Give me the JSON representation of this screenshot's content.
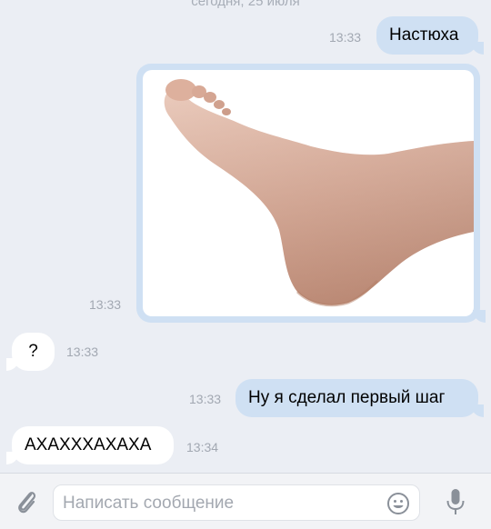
{
  "chat": {
    "date_separator": "сегодня, 25 июля",
    "messages": [
      {
        "direction": "outgoing",
        "type": "text",
        "text": "Настюха",
        "time": "13:33"
      },
      {
        "direction": "outgoing",
        "type": "photo",
        "photo_subject": "bare foot",
        "time": "13:33"
      },
      {
        "direction": "incoming",
        "type": "text",
        "text": "?",
        "time": "13:33"
      },
      {
        "direction": "outgoing",
        "type": "text",
        "text": "Ну я сделал первый шаг",
        "time": "13:33"
      },
      {
        "direction": "incoming",
        "type": "text",
        "text": "АХАХХХАХАХА",
        "time": "13:34"
      }
    ]
  },
  "composer": {
    "placeholder": "Написать сообщение",
    "icons": {
      "attach": "paperclip-icon",
      "emoji": "smiley-icon",
      "mic": "microphone-icon"
    }
  },
  "colors": {
    "background": "#ebeef4",
    "outgoing_bubble": "#cfe0f3",
    "incoming_bubble": "#ffffff",
    "timestamp": "#a2a8b2",
    "icon": "#8a9099"
  }
}
